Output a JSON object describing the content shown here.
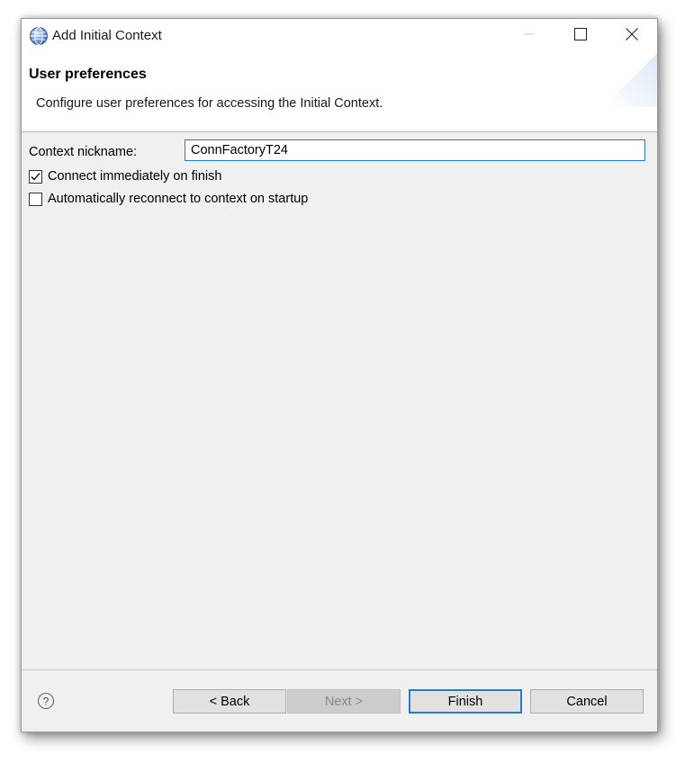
{
  "window": {
    "title": "Add Initial Context",
    "controls": {
      "minimize": "minimize-icon",
      "maximize": "maximize-icon",
      "close": "close-icon"
    }
  },
  "header": {
    "title": "User preferences",
    "description": "Configure user preferences for accessing the Initial Context."
  },
  "form": {
    "nickname_label": "Context nickname:",
    "nickname_value": "ConnFactoryT24",
    "options": [
      {
        "label": "Connect immediately on finish",
        "checked": true
      },
      {
        "label": "Automatically reconnect to context on startup",
        "checked": false
      }
    ]
  },
  "footer": {
    "help_icon": "help-icon",
    "back_label": "< Back",
    "next_label": "Next >",
    "finish_label": "Finish",
    "cancel_label": "Cancel"
  },
  "colors": {
    "accent": "#2b7bc4",
    "dialog_bg": "#f0f0f0"
  }
}
